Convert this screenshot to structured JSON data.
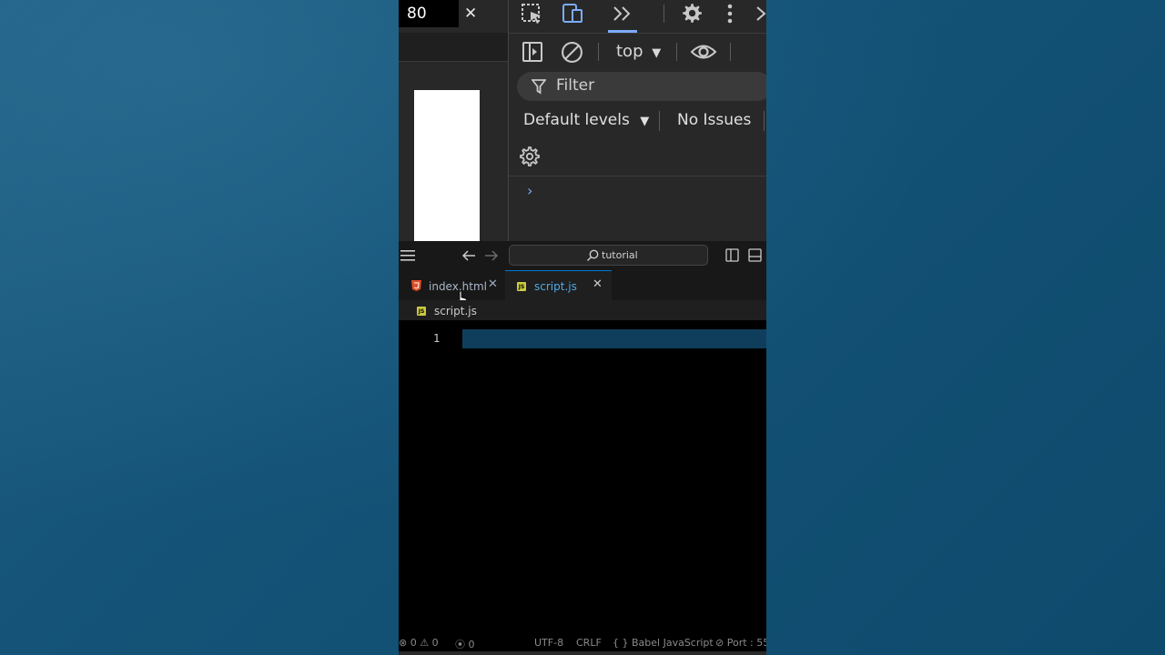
{
  "devtools": {
    "zoom_value": "80",
    "context_label": "top",
    "filter_placeholder": "Filter",
    "levels_label": "Default levels",
    "issues_label": "No Issues",
    "accent": "#7cacf8"
  },
  "editor": {
    "search_text": "tutorial",
    "tabs": [
      {
        "label": "index.html",
        "icon": "html5-icon",
        "active": false
      },
      {
        "label": "script.js",
        "icon": "js-icon",
        "active": true
      }
    ],
    "breadcrumb": "script.js",
    "line_number": "1",
    "status": {
      "errors": "0",
      "warnings": "0",
      "ports": "0",
      "encoding": "UTF-8",
      "line_ending": "CRLF",
      "language": "Babel JavaScript",
      "port": "Port : 55"
    }
  }
}
